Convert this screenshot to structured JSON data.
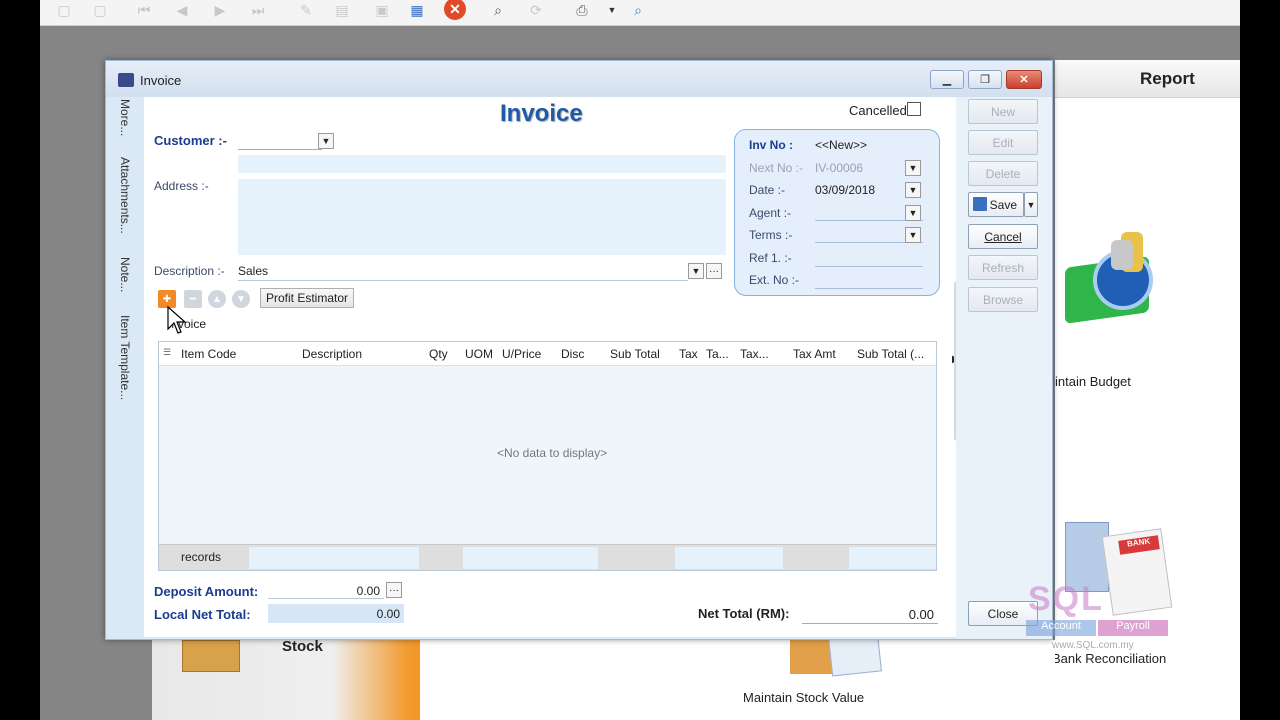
{
  "window": {
    "title": "Invoice",
    "heading": "Invoice",
    "cancelled_label": "Cancelled"
  },
  "side_tabs": [
    "More...",
    "Attachments...",
    "Note...",
    "Item Template..."
  ],
  "header": {
    "customer_label": "Customer :-",
    "address_label": "Address :-",
    "description_label": "Description :-",
    "description_value": "Sales",
    "profit_estimator": "Profit Estimator",
    "grid_tab": "Invoice"
  },
  "inv_box": {
    "inv_no_label": "Inv No :",
    "inv_no_value": "<<New>>",
    "next_no_label": "Next No :-",
    "next_no_value": "IV-00006",
    "date_label": "Date :-",
    "date_value": "03/09/2018",
    "agent_label": "Agent :-",
    "terms_label": "Terms :-",
    "ref1_label": "Ref 1. :-",
    "ext_no_label": "Ext. No :-"
  },
  "grid": {
    "columns": [
      "Item Code",
      "Description",
      "Qty",
      "UOM",
      "U/Price",
      "Disc",
      "Sub Total",
      "Tax",
      "Ta...",
      "Tax...",
      "Tax Amt",
      "Sub Total (..."
    ],
    "empty_text": "<No data to display>",
    "footer_label": "records"
  },
  "totals": {
    "deposit_label": "Deposit Amount:",
    "deposit_value": "0.00",
    "local_net_label": "Local Net Total:",
    "local_net_value": "0.00",
    "net_total_label": "Net Total (RM):",
    "net_total_value": "0.00"
  },
  "actions": {
    "new": "New",
    "edit": "Edit",
    "delete": "Delete",
    "save": "Save",
    "cancel": "Cancel",
    "refresh": "Refresh",
    "browse": "Browse",
    "close": "Close"
  },
  "background": {
    "report_header": "Report",
    "maintain_budget": "intain Budget",
    "bank_reconciliation": "Bank Reconciliation",
    "maintain_stock_value": "Maintain Stock Value",
    "stock": "Stock",
    "watermark_logo": "SQL",
    "watermark_account": "Account",
    "watermark_payroll": "Payroll",
    "watermark_url": "www.SQL.com.my"
  }
}
